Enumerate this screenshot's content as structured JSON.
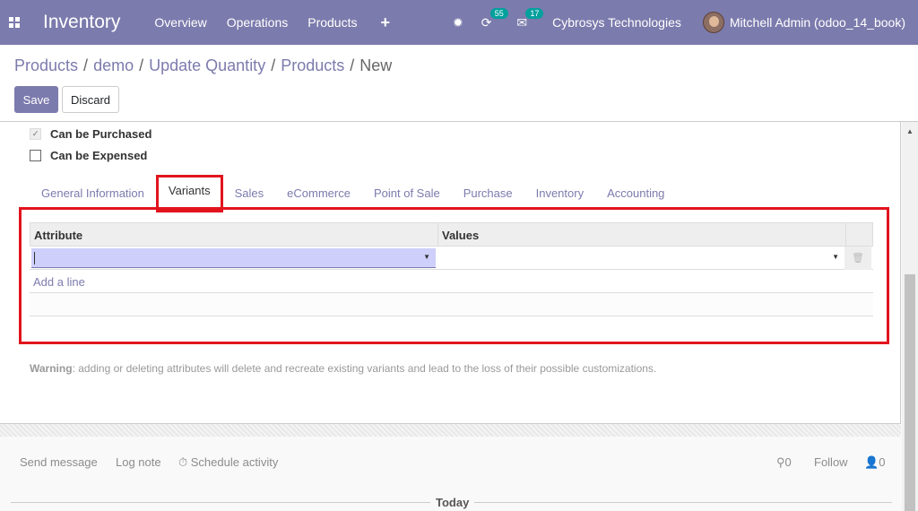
{
  "navbar": {
    "app_name": "Inventory",
    "menu": [
      "Overview",
      "Operations",
      "Products"
    ],
    "plus": "+",
    "activity_badge": "55",
    "messages_badge": "17",
    "company": "Cybrosys Technologies",
    "user": "Mitchell Admin (odoo_14_book)",
    "bug_icon": "✹",
    "clock_icon": "⟳",
    "chat_icon": "✉"
  },
  "breadcrumb": {
    "items": [
      "Products",
      "demo",
      "Update Quantity",
      "Products"
    ],
    "current": "New",
    "separator": "/"
  },
  "buttons": {
    "save": "Save",
    "discard": "Discard"
  },
  "form": {
    "can_be_purchased": "Can be Purchased",
    "can_be_expensed": "Can be Expensed",
    "tabs": [
      "General Information",
      "Variants",
      "Sales",
      "eCommerce",
      "Point of Sale",
      "Purchase",
      "Inventory",
      "Accounting"
    ],
    "active_tab": "Variants",
    "grid": {
      "col_attribute": "Attribute",
      "col_values": "Values",
      "add_line": "Add a line"
    },
    "warning_label": "Warning",
    "warning_text": ": adding or deleting attributes will delete and recreate existing variants and lead to the loss of their possible customizations."
  },
  "chatter": {
    "send_message": "Send message",
    "log_note": "Log note",
    "schedule_activity": "Schedule activity",
    "attachments_count": "0",
    "follow": "Follow",
    "followers_count": "0",
    "today": "Today"
  },
  "colors": {
    "navbar": "#7c7bad",
    "highlight": "#e1141e",
    "link": "#7c7bad"
  }
}
